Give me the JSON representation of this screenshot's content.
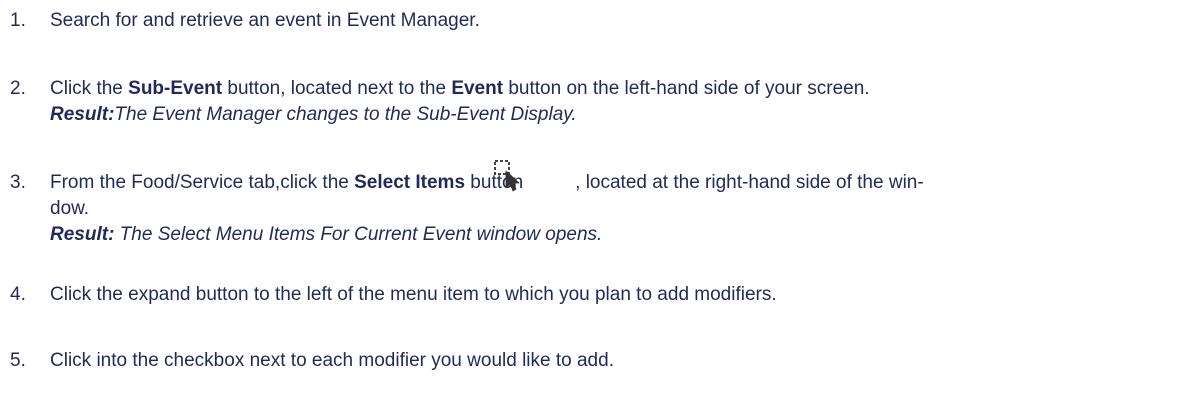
{
  "steps": [
    {
      "number": "1.",
      "text": "Search for and retrieve an event in Event Manager."
    },
    {
      "number": "2.",
      "pre": "Click the ",
      "bold1": "Sub-Event",
      "mid": " button, located next to the ",
      "bold2": "Event",
      "post": " button on the left-hand side of your screen.",
      "result_label": "Result:",
      "result_text": "The Event Manager changes to the Sub-Event Display."
    },
    {
      "number": "3.",
      "pre": "From the Food/Service tab,click the ",
      "bold1": "Select Items",
      "mid": " button",
      "post": ", located at the right-hand side of the win-",
      "line2": "dow.",
      "result_label": "Result:",
      "result_text": " The Select Menu Items For Current Event window opens.",
      "icon": "select-items-cursor-icon"
    },
    {
      "number": "4.",
      "text": "Click the expand button to the left of the menu item to which you plan to add modifiers."
    },
    {
      "number": "5.",
      "text": "Click into the checkbox next to each modifier you would like to add."
    }
  ]
}
